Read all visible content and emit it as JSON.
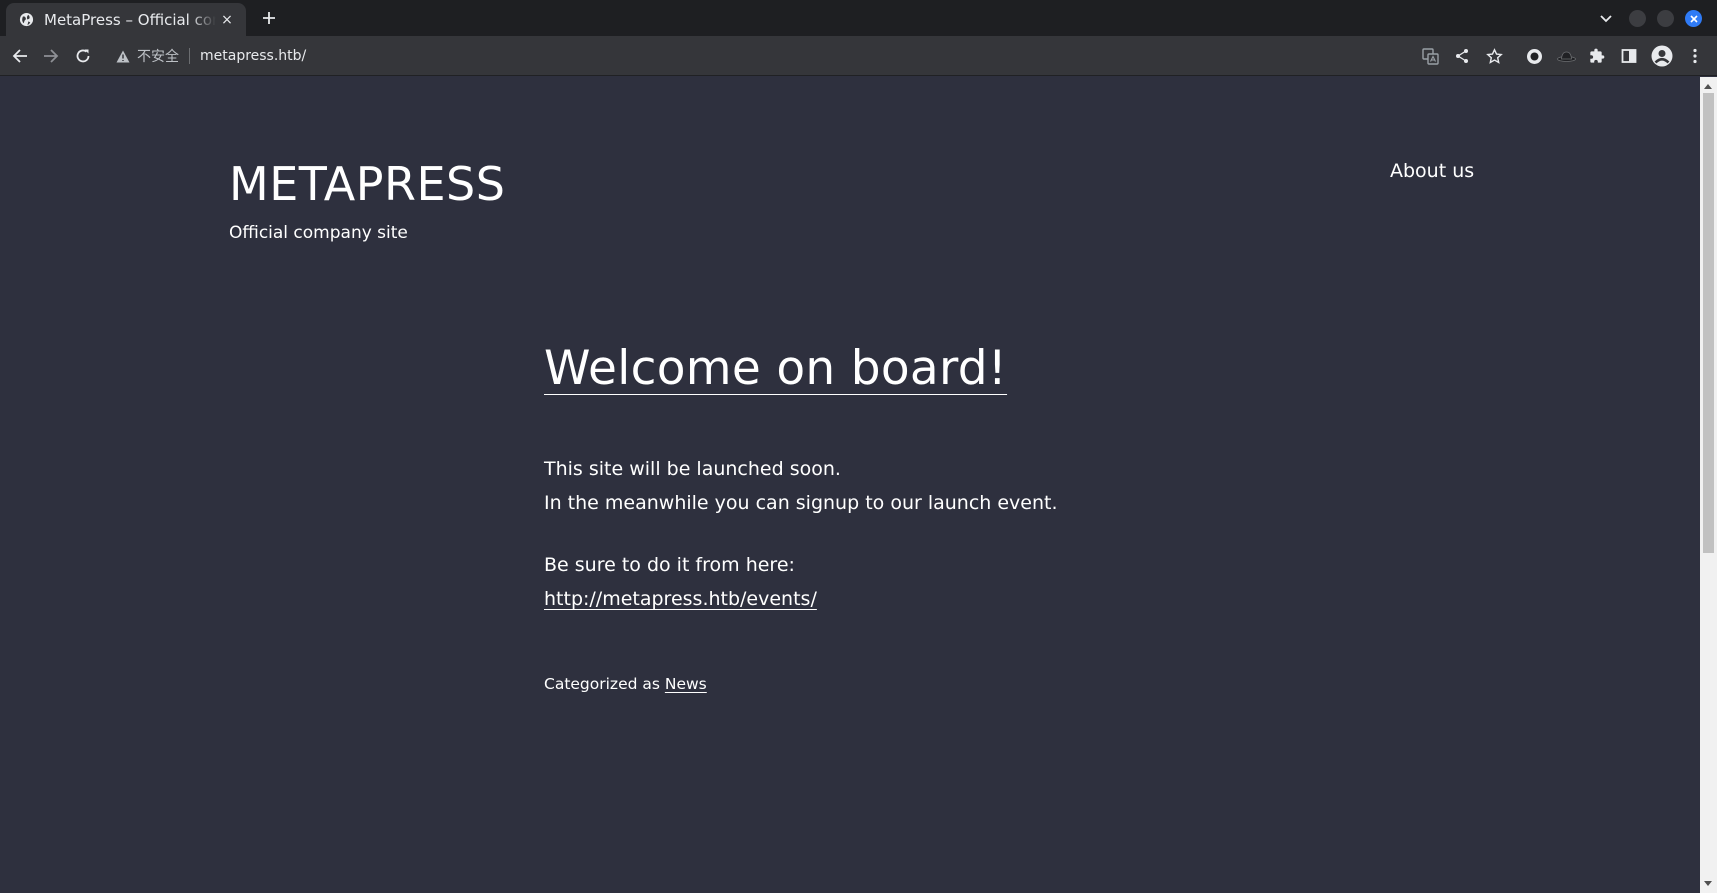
{
  "browser": {
    "tab": {
      "title": "MetaPress – Official company site",
      "close": "×"
    },
    "new_tab": "+",
    "security_text": "不安全",
    "url": "metapress.htb/"
  },
  "site": {
    "title": "METAPRESS",
    "description": "Official company site",
    "nav": [
      {
        "label": "About us"
      }
    ]
  },
  "post": {
    "title": "Welcome on board!",
    "lines1": [
      "This site will be launched soon.",
      "In the meanwhile you can signup to our launch event."
    ],
    "line3": "Be sure to do it from here:",
    "event_url": "http://metapress.htb/events/",
    "category_prefix": "Categorized as ",
    "category": "News"
  },
  "colors": {
    "page_bg": "#2e303e",
    "chrome_bg": "#35363a",
    "tabstrip_bg": "#1e1f22",
    "accent": "#2f7bf6"
  }
}
